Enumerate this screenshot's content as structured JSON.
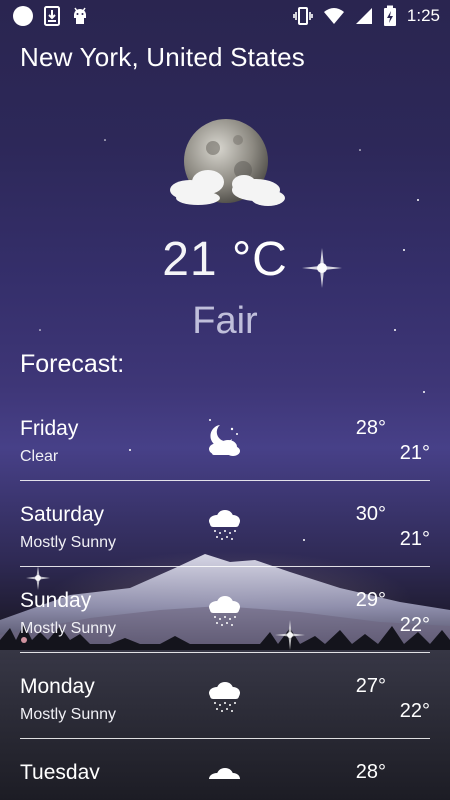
{
  "status_bar": {
    "left_icons": [
      "circle-icon",
      "download-icon",
      "android-icon"
    ],
    "right_icons": [
      "vibrate-icon",
      "wifi-icon",
      "signal-icon",
      "battery-charging-icon"
    ],
    "time": "1:25"
  },
  "location": "New York, United States",
  "current": {
    "temperature": "21",
    "unit": "°C",
    "condition": "Fair",
    "icon": "moon-cloud-icon"
  },
  "forecast_title": "Forecast:",
  "forecast": [
    {
      "day": "Friday",
      "desc": "Clear",
      "hi": "28°",
      "lo": "21°",
      "icon": "moon-cloud-icon"
    },
    {
      "day": "Saturday",
      "desc": "Mostly Sunny",
      "hi": "30°",
      "lo": "21°",
      "icon": "snow-cloud-icon"
    },
    {
      "day": "Sunday",
      "desc": "Mostly Sunny",
      "hi": "29°",
      "lo": "22°",
      "icon": "snow-cloud-icon"
    },
    {
      "day": "Monday",
      "desc": "Mostly Sunny",
      "hi": "27°",
      "lo": "22°",
      "icon": "snow-cloud-icon"
    },
    {
      "day": "Tuesday",
      "desc": "",
      "hi": "28°",
      "lo": "",
      "icon": "snow-cloud-icon"
    }
  ]
}
